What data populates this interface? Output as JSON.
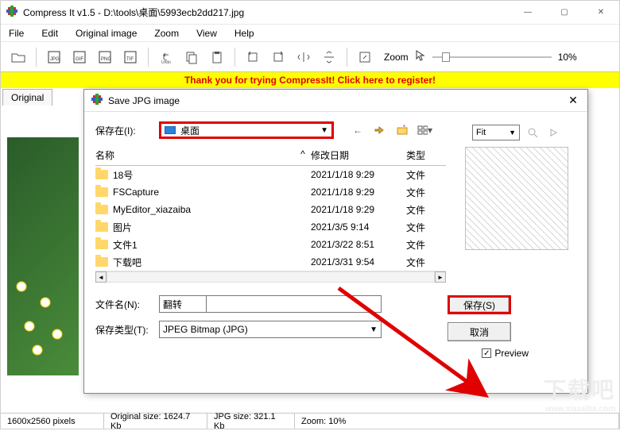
{
  "window": {
    "title": "Compress It v1.5 - D:\\tools\\桌面\\5993ecb2dd217.jpg",
    "minimize": "—",
    "maximize": "▢",
    "close": "✕"
  },
  "menu": {
    "file": "File",
    "edit": "Edit",
    "original": "Original image",
    "zoom": "Zoom",
    "view": "View",
    "help": "Help"
  },
  "toolbar": {
    "zoom_label": "Zoom",
    "zoom_value": "10%"
  },
  "banner": "Thank you for trying CompressIt! Click here to register!",
  "tab": {
    "original": "Original"
  },
  "status": {
    "dims": "1600x2560 pixels",
    "original_size": "Original size: 1624.7 Kb",
    "jpg_size": "JPG size: 321.1 Kb",
    "zoom": "Zoom: 10%"
  },
  "dialog": {
    "title": "Save JPG image",
    "close": "✕",
    "savein_label": "保存在(I):",
    "savein_value": "桌面",
    "fit_label": "Fit",
    "columns": {
      "name": "名称",
      "date": "修改日期",
      "type": "类型"
    },
    "files": [
      {
        "name": "18号",
        "date": "2021/1/18 9:29",
        "type": "文件"
      },
      {
        "name": "FSCapture",
        "date": "2021/1/18 9:29",
        "type": "文件"
      },
      {
        "name": "MyEditor_xiazaiba",
        "date": "2021/1/18 9:29",
        "type": "文件"
      },
      {
        "name": "图片",
        "date": "2021/3/5 9:14",
        "type": "文件"
      },
      {
        "name": "文件1",
        "date": "2021/3/22 8:51",
        "type": "文件"
      },
      {
        "name": "下载吧",
        "date": "2021/3/31 9:54",
        "type": "文件"
      }
    ],
    "filename_label": "文件名(N):",
    "filename_value": "翻转",
    "filetype_label": "保存类型(T):",
    "filetype_value": "JPEG Bitmap (JPG)",
    "save_btn": "保存(S)",
    "cancel_btn": "取消",
    "preview_label": "Preview"
  },
  "watermark": {
    "main": "下载吧",
    "sub": "www.xiazaiba.com"
  }
}
